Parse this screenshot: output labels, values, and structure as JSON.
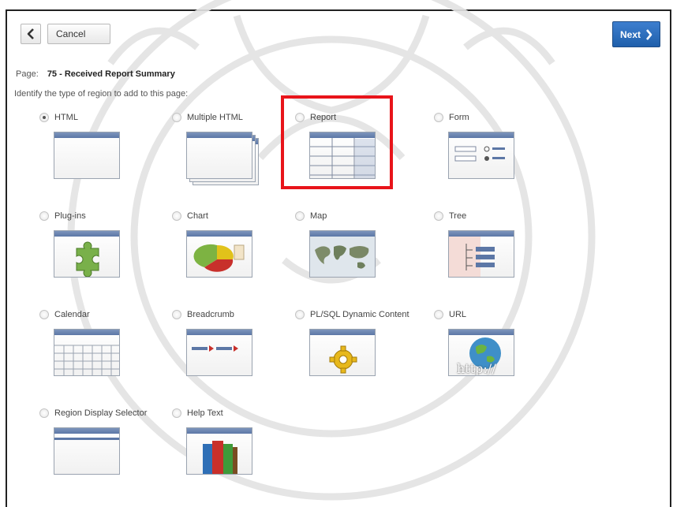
{
  "toolbar": {
    "cancel_label": "Cancel",
    "next_label": "Next"
  },
  "page": {
    "label": "Page:",
    "value": "75 - Received Report Summary"
  },
  "instructions": "Identify the type of region to add to this page:",
  "options": [
    {
      "label": "HTML",
      "checked": true
    },
    {
      "label": "Multiple HTML",
      "checked": false
    },
    {
      "label": "Report",
      "checked": false
    },
    {
      "label": "Form",
      "checked": false
    },
    {
      "label": "Plug-ins",
      "checked": false
    },
    {
      "label": "Chart",
      "checked": false
    },
    {
      "label": "Map",
      "checked": false
    },
    {
      "label": "Tree",
      "checked": false
    },
    {
      "label": "Calendar",
      "checked": false
    },
    {
      "label": "Breadcrumb",
      "checked": false
    },
    {
      "label": "PL/SQL Dynamic Content",
      "checked": false
    },
    {
      "label": "URL",
      "checked": false
    },
    {
      "label": "Region Display Selector",
      "checked": false
    },
    {
      "label": "Help Text",
      "checked": false
    }
  ],
  "url_thumb_text": "http://",
  "colors": {
    "accent": "#1f5fab",
    "highlight": "#e8141a",
    "thumb_bar": "#5c77a6"
  }
}
